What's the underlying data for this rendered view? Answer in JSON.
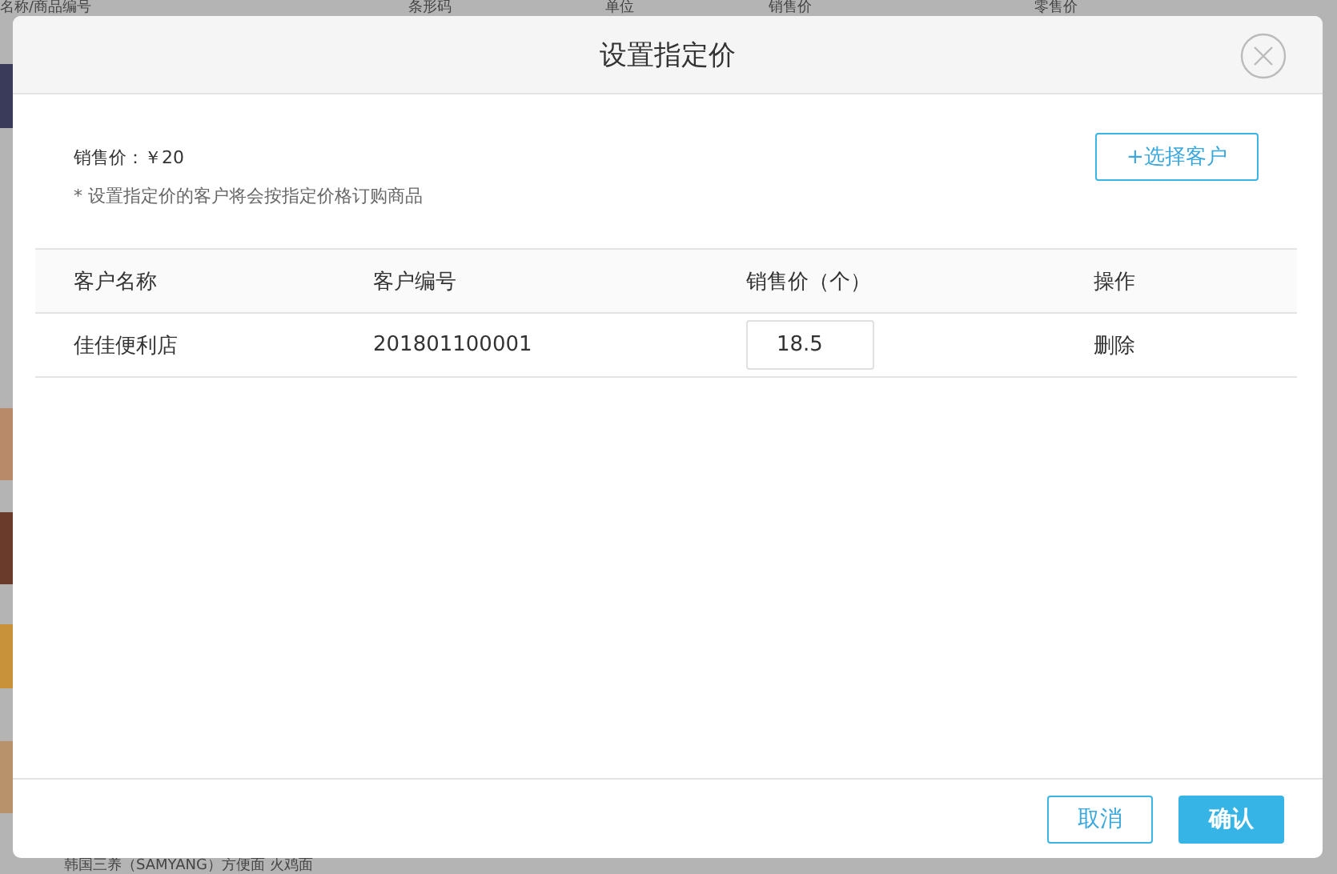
{
  "background_page": {
    "columns": [
      "名称/商品编号",
      "条形码",
      "单位",
      "销售价",
      "零售价"
    ],
    "bottom_item": "韩国三养（SAMYANG）方便面 火鸡面"
  },
  "dialog": {
    "title": "设置指定价",
    "price_label": "销售价：",
    "price_value": "￥20",
    "note": "* 设置指定价的客户将会按指定价格订购商品",
    "add_button": "+选择客户",
    "table": {
      "columns": [
        "客户名称",
        "客户编号",
        "销售价（个）",
        "操作"
      ],
      "rows": [
        {
          "name": "佳佳便利店",
          "code": "201801100001",
          "price": "18.5",
          "action": "删除"
        }
      ]
    },
    "buttons": [
      {
        "label": "取消",
        "kind": "secondary"
      },
      {
        "label": "确认",
        "kind": "primary"
      }
    ]
  }
}
